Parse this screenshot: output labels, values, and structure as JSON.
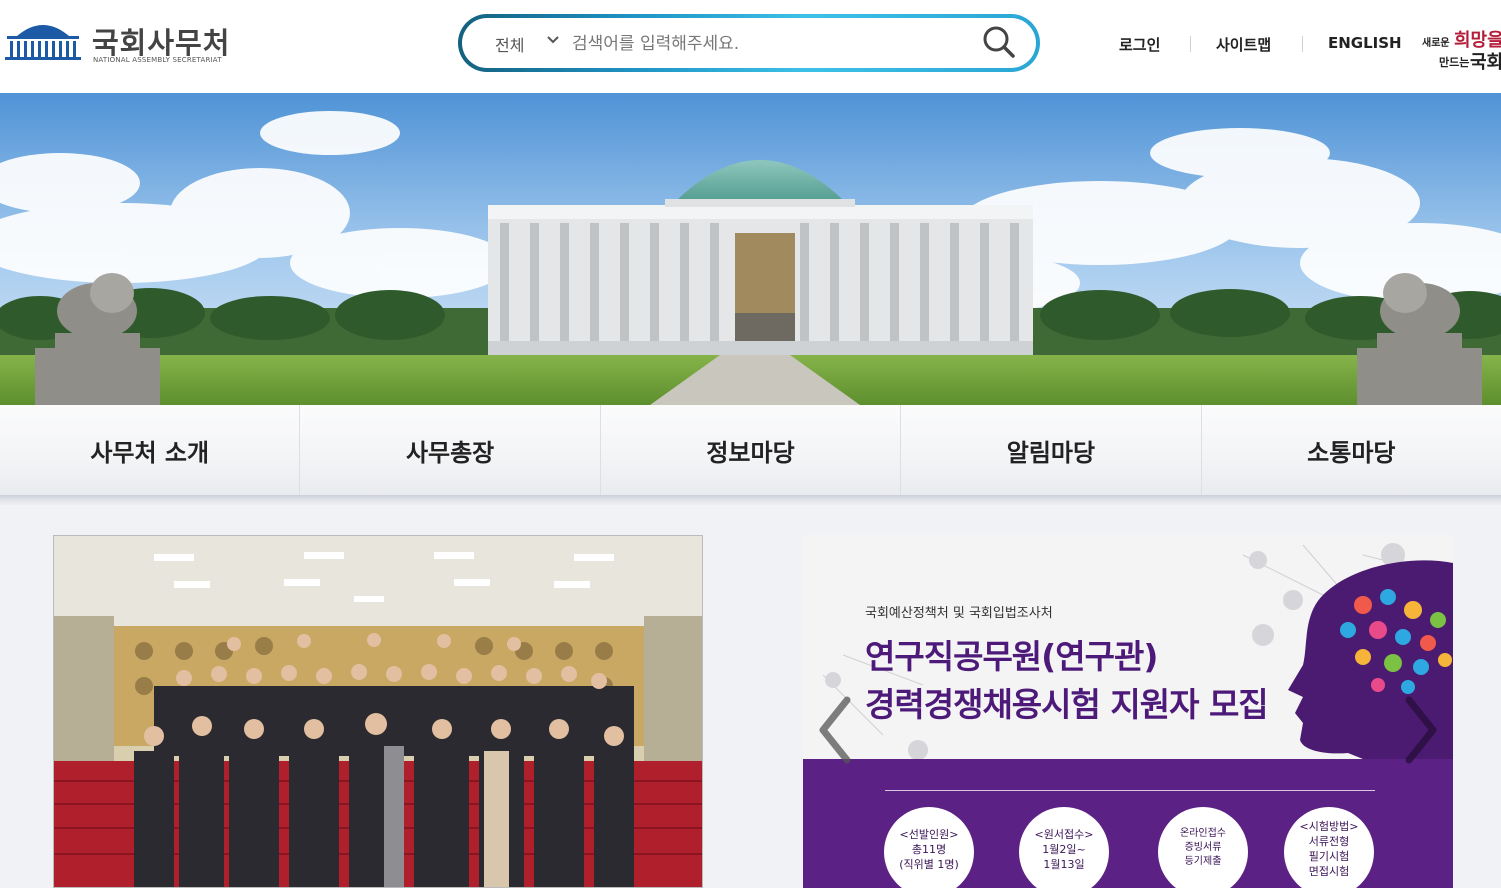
{
  "header": {
    "logo_title": "국회사무처",
    "logo_subtitle": "NATIONAL ASSEMBLY SECRETARIAT",
    "search": {
      "category": "전체",
      "placeholder": "검색어를 입력해주세요.",
      "value": ""
    },
    "links": [
      "로그인",
      "사이트맵",
      "ENGLISH"
    ],
    "slogan": {
      "line1_prefix": "새로운",
      "line1_emph": "희망을",
      "line2_prefix": "만드는",
      "line2_emph": "국회"
    }
  },
  "nav": [
    "사무처 소개",
    "사무총장",
    "정보마당",
    "알림마당",
    "소통마당"
  ],
  "banner": {
    "org": "국회예산정책처 및 국회입법조사처",
    "title_line1": "연구직공무원(연구관)",
    "title_line2": "경력경쟁채용시험 지원자 모집",
    "circles": [
      {
        "lines": [
          "<선발인원>",
          "총11명",
          "(직위별 1명)"
        ]
      },
      {
        "lines": [
          "<원서접수>",
          "1월2일~",
          "1월13일"
        ]
      },
      {
        "lines": [
          "온라인접수",
          "증빙서류",
          "등기제출"
        ]
      },
      {
        "lines": [
          "<시험방법>",
          "서류전형",
          "필기시험",
          "면접시험"
        ]
      }
    ]
  },
  "colors": {
    "search_gradient_start": "#14607f",
    "search_gradient_end": "#3cc1e8",
    "banner_purple": "#5c2185",
    "banner_title": "#4d1a7a",
    "slogan_red": "#b41d3a"
  },
  "icons": [
    "search-icon",
    "chevron-down-icon",
    "chevron-left-icon",
    "chevron-right-icon",
    "assembly-logo-icon"
  ]
}
